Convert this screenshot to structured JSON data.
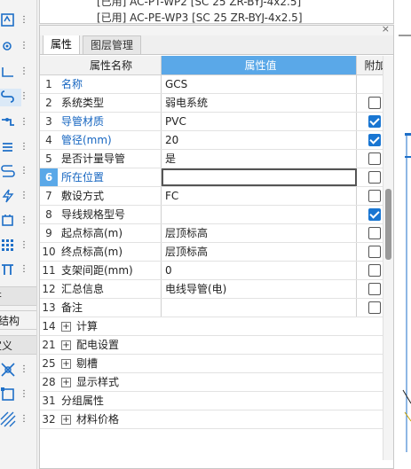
{
  "top_strip": {
    "line1": "[已用] AC-PT-WP2 [SC 25 ZR-BYJ-4x2.5]",
    "line2": "[已用] AC-PE-WP3 [SC 25 ZR-BYJ-4x2.5]"
  },
  "left_sidebar": {
    "label1": "符",
    "label2": "筑结构",
    "label3": "定义"
  },
  "tabs": [
    {
      "label": "属性"
    },
    {
      "label": "图层管理"
    }
  ],
  "table": {
    "headers": {
      "name": "属性名称",
      "value": "属性值",
      "add": "附加"
    },
    "rows": [
      {
        "num": "1",
        "name": "名称",
        "value": "GCS",
        "checked": null
      },
      {
        "num": "2",
        "name": "系统类型",
        "value": "弱电系统",
        "checked": false
      },
      {
        "num": "3",
        "name": "导管材质",
        "value": "PVC",
        "checked": true
      },
      {
        "num": "4",
        "name": "管径(mm)",
        "value": "20",
        "checked": true
      },
      {
        "num": "5",
        "name": "是否计量导管",
        "value": "是",
        "checked": false
      },
      {
        "num": "6",
        "name": "所在位置",
        "value": "",
        "checked": false
      },
      {
        "num": "7",
        "name": "敷设方式",
        "value": "FC",
        "checked": false
      },
      {
        "num": "8",
        "name": "导线规格型号",
        "value": "",
        "checked": true
      },
      {
        "num": "9",
        "name": "起点标高(m)",
        "value": "层顶标高",
        "checked": false
      },
      {
        "num": "10",
        "name": "终点标高(m)",
        "value": "层顶标高",
        "checked": false
      },
      {
        "num": "11",
        "name": "支架间距(mm)",
        "value": "0",
        "checked": false
      },
      {
        "num": "12",
        "name": "汇总信息",
        "value": "电线导管(电)",
        "checked": false
      },
      {
        "num": "13",
        "name": "备注",
        "value": "",
        "checked": false
      }
    ],
    "groups": [
      {
        "num": "14",
        "name": "计算",
        "expand": "+"
      },
      {
        "num": "21",
        "name": "配电设置",
        "expand": "+"
      },
      {
        "num": "25",
        "name": "剔槽",
        "expand": "+"
      },
      {
        "num": "28",
        "name": "显示样式",
        "expand": "+"
      },
      {
        "num": "31",
        "name": "分组属性",
        "expand": ""
      },
      {
        "num": "32",
        "name": "材料价格",
        "expand": "+"
      }
    ]
  },
  "panel": {
    "close": "×"
  },
  "colors": {
    "accent": "#5aa8e8",
    "blue_text": "#1565c0",
    "check": "#1976d2"
  }
}
